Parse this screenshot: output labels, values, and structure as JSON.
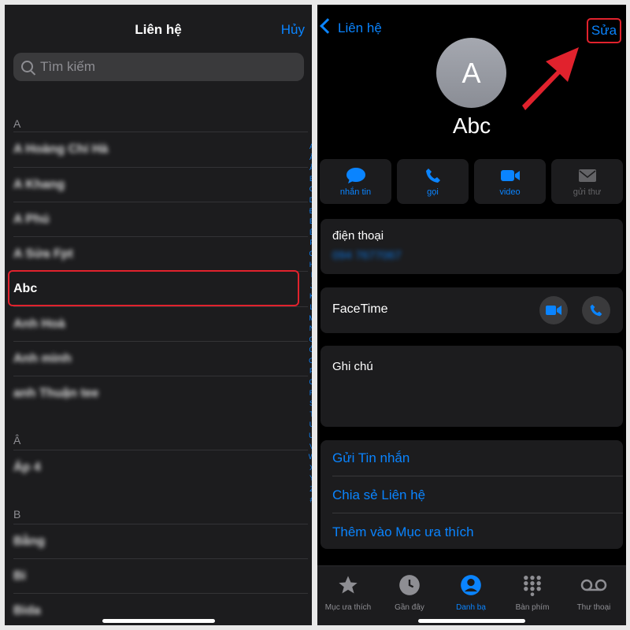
{
  "left": {
    "title": "Liên hệ",
    "cancel": "Hủy",
    "search_placeholder": "Tìm kiếm",
    "sections": [
      {
        "letter": "A",
        "contacts": [
          "A Hoàng Chí Hà",
          "A Khang",
          "A Phú",
          "A Sửa Fpt",
          "Abc",
          "Anh Hoà",
          "Anh mình",
          "anh Thuận tee"
        ]
      },
      {
        "letter": "Â",
        "contacts": [
          "Áp 4"
        ]
      },
      {
        "letter": "B",
        "contacts": [
          "Bằng",
          "Bi",
          "Bida"
        ]
      }
    ],
    "index_letters": [
      "A",
      "Ă",
      "Â",
      "B",
      "C",
      "D",
      "Đ",
      "E",
      "Ê",
      "F",
      "G",
      "H",
      "I",
      "J",
      "K",
      "L",
      "M",
      "N",
      "O",
      "Ô",
      "Ơ",
      "P",
      "Q",
      "R",
      "S",
      "T",
      "U",
      "Ư",
      "V",
      "W",
      "X",
      "Y",
      "Z",
      "#"
    ]
  },
  "right": {
    "back_label": "Liên hệ",
    "edit_label": "Sửa",
    "avatar_initial": "A",
    "contact_name": "Abc",
    "actions": [
      {
        "label": "nhắn tin",
        "icon": "message-icon",
        "enabled": true
      },
      {
        "label": "gọi",
        "icon": "phone-icon",
        "enabled": true
      },
      {
        "label": "video",
        "icon": "video-icon",
        "enabled": true
      },
      {
        "label": "gửi thư",
        "icon": "mail-icon",
        "enabled": false
      }
    ],
    "phone_label": "điện thoại",
    "phone_value": "094 7677067",
    "facetime_label": "FaceTime",
    "notes_label": "Ghi chú",
    "links": [
      "Gửi Tin nhắn",
      "Chia sẻ Liên hệ",
      "Thêm vào Mục ưa thích"
    ],
    "tabs": [
      {
        "label": "Mục ưa thích",
        "icon": "star-icon",
        "active": false
      },
      {
        "label": "Gần đây",
        "icon": "clock-icon",
        "active": false
      },
      {
        "label": "Danh bạ",
        "icon": "person-icon",
        "active": true
      },
      {
        "label": "Bàn phím",
        "icon": "keypad-icon",
        "active": false
      },
      {
        "label": "Thư thoại",
        "icon": "voicemail-icon",
        "active": false
      }
    ]
  },
  "colors": {
    "accent": "#0a84ff",
    "highlight": "#e1222d",
    "background": "#000000",
    "card": "#1c1c1e"
  }
}
